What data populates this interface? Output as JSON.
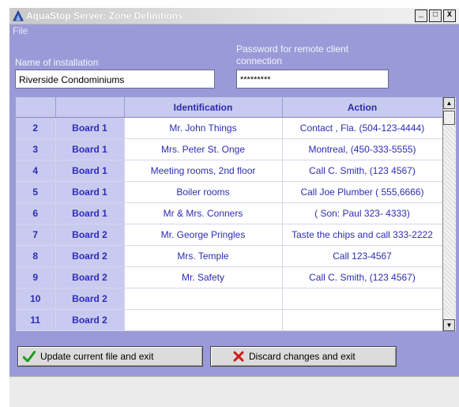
{
  "window": {
    "title": "AquaStop Server: Zone Definitions",
    "controls": {
      "minimize": "_",
      "maximize": "□",
      "close": "X"
    }
  },
  "menu": {
    "items": [
      {
        "label": "File"
      }
    ]
  },
  "installation": {
    "label": "Name of installation",
    "value": "Riverside Condominiums"
  },
  "password": {
    "label_line1": "Password for remote client",
    "label_line2": "connection",
    "value": "*********"
  },
  "table": {
    "columns": [
      "",
      "",
      "Identification",
      "Action"
    ],
    "rows": [
      {
        "num": "2",
        "board": "Board 1",
        "identification": "Mr. John Things",
        "action": "Contact , Fla. (504-123-4444)"
      },
      {
        "num": "3",
        "board": "Board 1",
        "identification": "Mrs. Peter  St. Onge",
        "action": "Montreal, (450-333-5555)"
      },
      {
        "num": "4",
        "board": "Board 1",
        "identification": "Meeting rooms, 2nd floor",
        "action": "Call C. Smith, (123 4567)"
      },
      {
        "num": "5",
        "board": "Board 1",
        "identification": "Boiler rooms",
        "action": "Call Joe Plumber ( 555,6666)"
      },
      {
        "num": "6",
        "board": "Board 1",
        "identification": "Mr & Mrs. Conners",
        "action": "( Son: Paul 323- 4333)"
      },
      {
        "num": "7",
        "board": "Board 2",
        "identification": "Mr. George Pringles",
        "action": "Taste the chips and call 333-2222"
      },
      {
        "num": "8",
        "board": "Board 2",
        "identification": "Mrs. Temple",
        "action": "Call 123-4567"
      },
      {
        "num": "9",
        "board": "Board 2",
        "identification": "Mr. Safety",
        "action": "Call C. Smith, (123 4567)"
      },
      {
        "num": "10",
        "board": "Board 2",
        "identification": "",
        "action": ""
      },
      {
        "num": "11",
        "board": "Board 2",
        "identification": "",
        "action": ""
      }
    ]
  },
  "buttons": {
    "update": {
      "label": "Update current file and exit",
      "icon": "checkmark-icon",
      "color": "#1e9a1e"
    },
    "discard": {
      "label": "Discard changes and exit",
      "icon": "x-cross-icon",
      "color": "#cc1a1a"
    }
  },
  "colors": {
    "window_bg": "#9a9ad8",
    "header_bg": "#c9caf0",
    "header_text": "#2b2ba8"
  }
}
